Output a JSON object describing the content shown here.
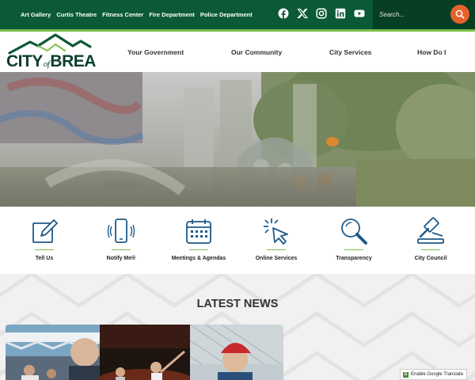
{
  "topbar": {
    "links": [
      "Art Gallery",
      "Curtis Theatre",
      "Fitness Center",
      "Fire Department",
      "Police Department"
    ],
    "social_icons": [
      "facebook-icon",
      "x-icon",
      "instagram-icon",
      "linkedin-icon",
      "youtube-icon"
    ],
    "search_placeholder": "Search..."
  },
  "logo": {
    "city": "CITY",
    "of": "of",
    "name": "BREA"
  },
  "nav": [
    "Your Government",
    "Our Community",
    "City Services",
    "How Do I"
  ],
  "quick_links": [
    {
      "label": "Tell Us",
      "icon": "edit-icon"
    },
    {
      "label": "Notify Me®",
      "icon": "phone-notify-icon"
    },
    {
      "label": "Meetings & Agendas",
      "icon": "calendar-icon"
    },
    {
      "label": "Online Services",
      "icon": "click-cursor-icon"
    },
    {
      "label": "Transparency",
      "icon": "magnifier-icon"
    },
    {
      "label": "City Council",
      "icon": "gavel-icon"
    }
  ],
  "news": {
    "title": "LATEST NEWS"
  },
  "translate": {
    "label": "Enable Google Translate"
  },
  "colors": {
    "dark_green": "#0b5a35",
    "accent_green": "#7cc04b",
    "search_orange": "#e5622a",
    "icon_blue": "#1e5a8a"
  }
}
